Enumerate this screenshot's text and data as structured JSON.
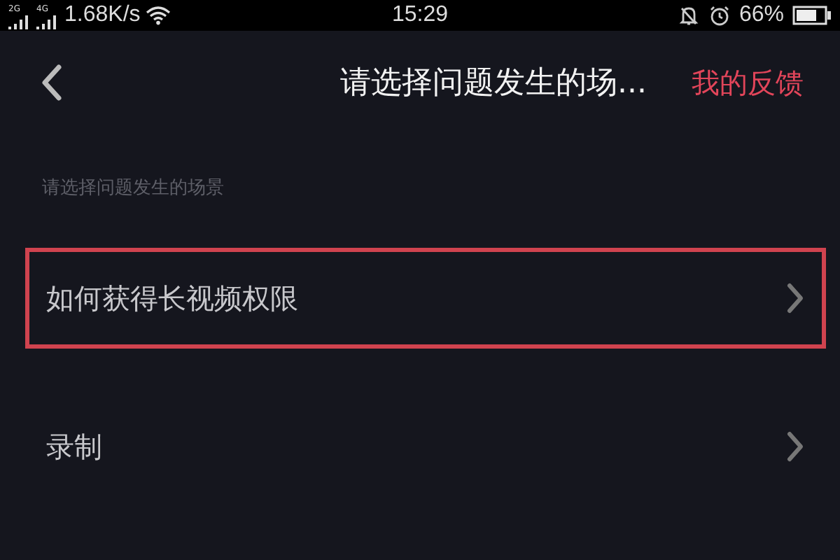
{
  "status_bar": {
    "networks": [
      {
        "label": "2G"
      },
      {
        "label": "4G"
      }
    ],
    "speed": "1.68K/s",
    "time": "15:29",
    "battery": "66%"
  },
  "nav_bar": {
    "title": "请选择问题发生的场...",
    "action": "我的反馈"
  },
  "section": {
    "header": "请选择问题发生的场景",
    "items": [
      {
        "label": "如何获得长视频权限",
        "highlighted": true
      },
      {
        "label": "录制",
        "highlighted": false
      }
    ]
  }
}
